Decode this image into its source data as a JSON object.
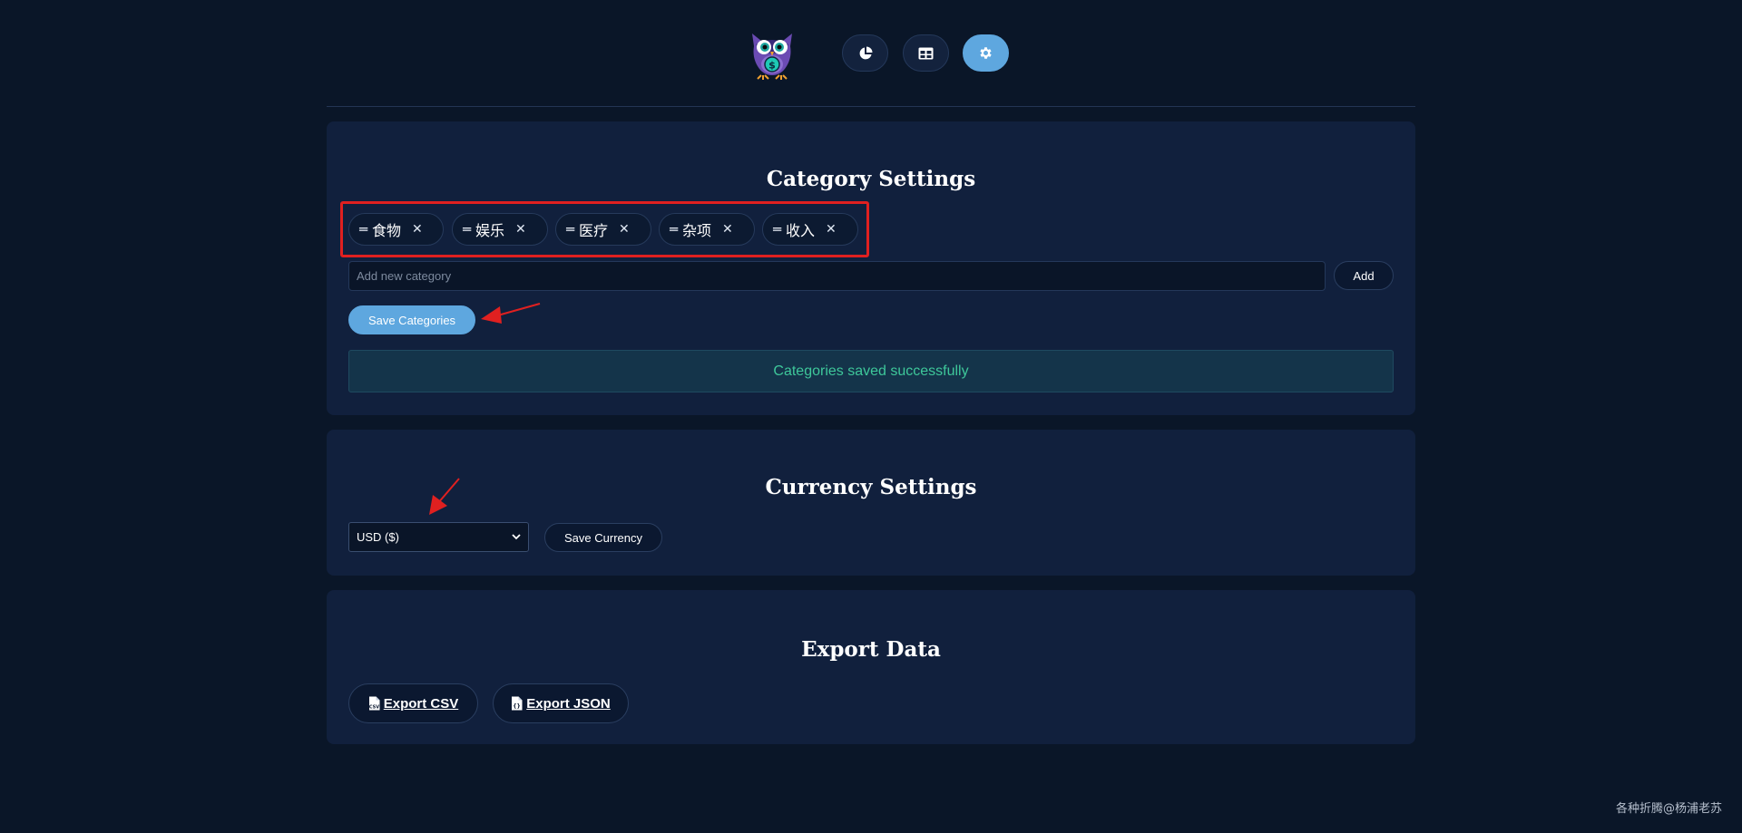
{
  "header": {
    "logo_icon": "owl-dollar-logo",
    "nav": [
      {
        "icon": "pie-chart-icon",
        "active": false
      },
      {
        "icon": "table-icon",
        "active": false
      },
      {
        "icon": "gear-icon",
        "active": true
      }
    ]
  },
  "categories": {
    "title": "Category Settings",
    "items": [
      "食物",
      "娱乐",
      "医疗",
      "杂项",
      "收入"
    ],
    "input_placeholder": "Add new category",
    "input_value": "",
    "add_label": "Add",
    "save_label": "Save Categories",
    "success_message": "Categories saved successfully"
  },
  "currency": {
    "title": "Currency Settings",
    "selected": "USD ($)",
    "save_label": "Save Currency"
  },
  "export": {
    "title": "Export Data",
    "csv_label": "Export CSV",
    "json_label": "Export JSON"
  },
  "watermark": "各种折腾@杨浦老苏",
  "colors": {
    "background": "#0a1628",
    "card": "#11203d",
    "accent": "#5ea7df",
    "success_text": "#3ec79a",
    "annotation": "#e02020"
  }
}
